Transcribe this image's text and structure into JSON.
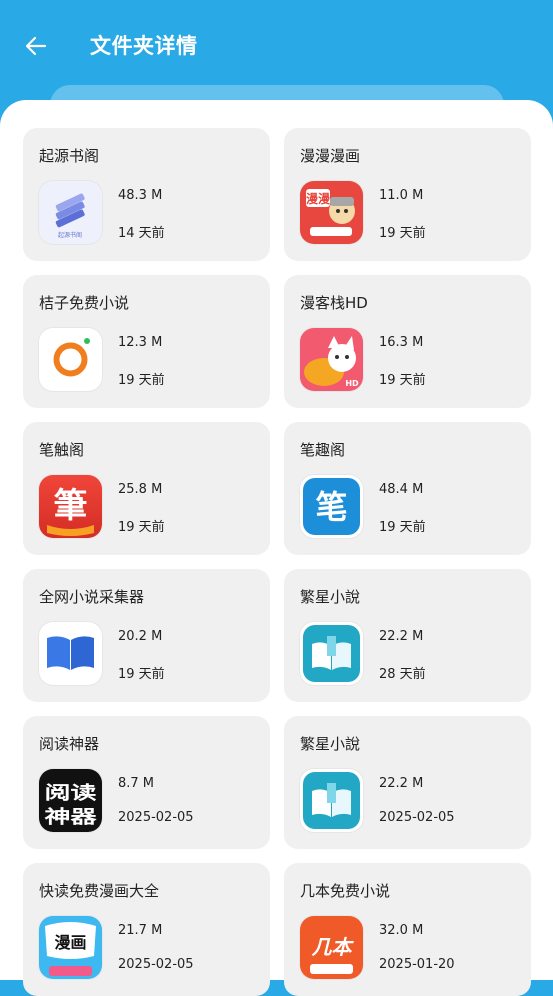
{
  "header": {
    "title": "文件夹详情"
  },
  "folders": [
    {
      "name": "起源书阁",
      "size": "48.3 M",
      "time": "14 天前",
      "icon": "book-stack-icon",
      "icon_label": "起源书阁"
    },
    {
      "name": "漫漫漫画",
      "size": "11.0 M",
      "time": "19 天前",
      "icon": "comic-icon",
      "icon_label": "漫漫"
    },
    {
      "name": "桔子免费小说",
      "size": "12.3 M",
      "time": "19 天前",
      "icon": "orange-ring-icon"
    },
    {
      "name": "漫客栈HD",
      "size": "16.3 M",
      "time": "19 天前",
      "icon": "cat-icon",
      "icon_label": "HD"
    },
    {
      "name": "笔触阁",
      "size": "25.8 M",
      "time": "19 天前",
      "icon": "brush-char-icon",
      "icon_label": "筆"
    },
    {
      "name": "笔趣阁",
      "size": "48.4 M",
      "time": "19 天前",
      "icon": "pen-char-icon",
      "icon_label": "笔"
    },
    {
      "name": "全网小说采集器",
      "size": "20.2 M",
      "time": "19 天前",
      "icon": "open-book-icon"
    },
    {
      "name": "繁星小說",
      "size": "22.2 M",
      "time": "28 天前",
      "icon": "star-book-icon"
    },
    {
      "name": "阅读神器",
      "size": "8.7 M",
      "time": "2025-02-05",
      "icon": "reading-tool-icon",
      "icon_label": "阅读神器"
    },
    {
      "name": "繁星小說",
      "size": "22.2 M",
      "time": "2025-02-05",
      "icon": "star-book-icon"
    },
    {
      "name": "快读免费漫画大全",
      "size": "21.7 M",
      "time": "2025-02-05",
      "icon": "manga-bubble-icon",
      "icon_label": "漫画"
    },
    {
      "name": "几本免费小说",
      "size": "32.0 M",
      "time": "2025-01-20",
      "icon": "jiben-icon",
      "icon_label": "几本"
    }
  ]
}
